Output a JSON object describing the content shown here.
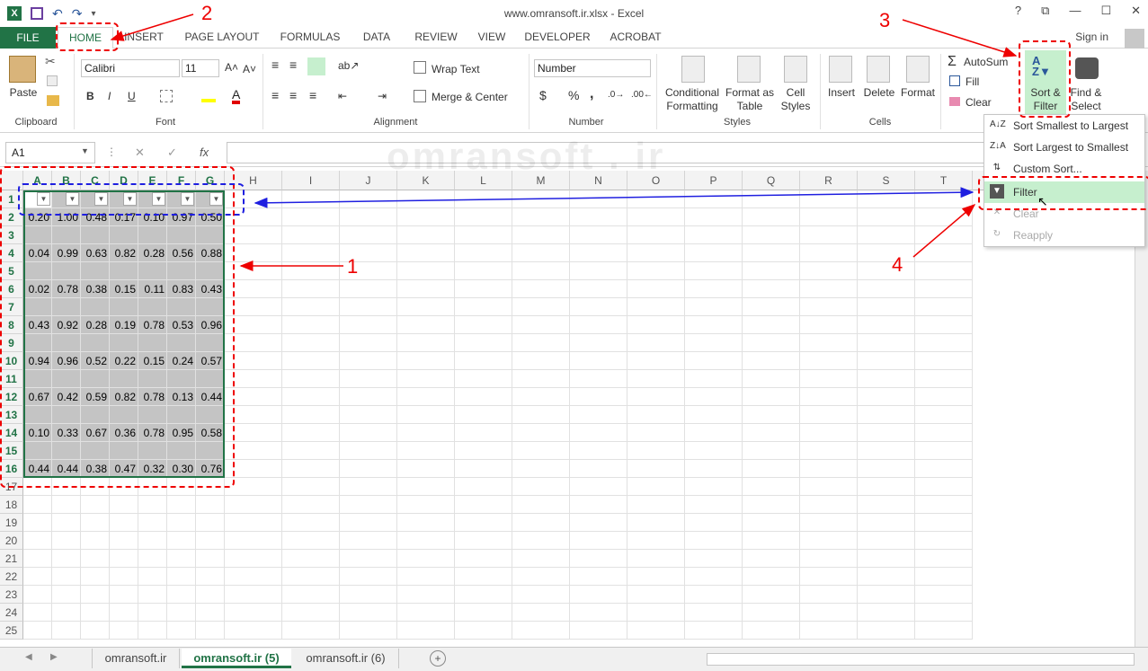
{
  "window": {
    "title": "www.omransoft.ir.xlsx - Excel",
    "help": "?",
    "restore": "⧉",
    "minimize": "—",
    "maximize": "☐",
    "close": "✕"
  },
  "tabs": [
    {
      "label": "FILE"
    },
    {
      "label": "HOME"
    },
    {
      "label": "INSERT"
    },
    {
      "label": "PAGE LAYOUT"
    },
    {
      "label": "FORMULAS"
    },
    {
      "label": "DATA"
    },
    {
      "label": "REVIEW"
    },
    {
      "label": "VIEW"
    },
    {
      "label": "DEVELOPER"
    },
    {
      "label": "ACROBAT"
    }
  ],
  "signin": "Sign in",
  "ribbon": {
    "clipboard": {
      "label": "Clipboard",
      "paste": "Paste"
    },
    "font": {
      "label": "Font",
      "name": "Calibri",
      "size": "11",
      "bold": "B",
      "italic": "I",
      "underline": "U"
    },
    "alignment": {
      "label": "Alignment",
      "wrap": "Wrap Text",
      "merge": "Merge & Center"
    },
    "number": {
      "label": "Number",
      "format": "Number",
      "currency": "$",
      "percent": "%",
      "comma": ","
    },
    "styles": {
      "label": "Styles",
      "conditional_1": "Conditional",
      "conditional_2": "Formatting",
      "format_table_1": "Format as",
      "format_table_2": "Table",
      "cell_styles_1": "Cell",
      "cell_styles_2": "Styles"
    },
    "cells": {
      "label": "Cells",
      "insert": "Insert",
      "delete": "Delete",
      "format": "Format"
    },
    "editing": {
      "autosum": "AutoSum",
      "fill": "Fill",
      "clear": "Clear",
      "sort_1": "Sort &",
      "sort_2": "Filter",
      "find_1": "Find &",
      "find_2": "Select"
    }
  },
  "formula_bar": {
    "name_box": "A1",
    "cancel": "✕",
    "enter": "✓",
    "fx": "fx",
    "value": ""
  },
  "watermark": "omransoft . ir",
  "columns": [
    "A",
    "B",
    "C",
    "D",
    "E",
    "F",
    "G",
    "H",
    "I",
    "J",
    "K",
    "L",
    "M",
    "N",
    "O",
    "P",
    "Q",
    "R",
    "S",
    "T"
  ],
  "rows": [
    "1",
    "2",
    "3",
    "4",
    "5",
    "6",
    "7",
    "8",
    "9",
    "10",
    "11",
    "12",
    "13",
    "14",
    "15",
    "16",
    "17",
    "18",
    "19",
    "20",
    "21",
    "22",
    "23",
    "24",
    "25"
  ],
  "data_rows": {
    "2": [
      "0.20",
      "1.00",
      "0.48",
      "0.17",
      "0.10",
      "0.97",
      "0.50"
    ],
    "4": [
      "0.04",
      "0.99",
      "0.63",
      "0.82",
      "0.28",
      "0.56",
      "0.88"
    ],
    "6": [
      "0.02",
      "0.78",
      "0.38",
      "0.15",
      "0.11",
      "0.83",
      "0.43"
    ],
    "8": [
      "0.43",
      "0.92",
      "0.28",
      "0.19",
      "0.78",
      "0.53",
      "0.96"
    ],
    "10": [
      "0.94",
      "0.96",
      "0.52",
      "0.22",
      "0.15",
      "0.24",
      "0.57"
    ],
    "12": [
      "0.67",
      "0.42",
      "0.59",
      "0.82",
      "0.78",
      "0.13",
      "0.44"
    ],
    "14": [
      "0.10",
      "0.33",
      "0.67",
      "0.36",
      "0.78",
      "0.95",
      "0.58"
    ],
    "16": [
      "0.44",
      "0.44",
      "0.38",
      "0.47",
      "0.32",
      "0.30",
      "0.76"
    ]
  },
  "sort_menu": [
    {
      "label": "Sort Smallest to Largest",
      "icon": "A↓Z",
      "enabled": true
    },
    {
      "label": "Sort Largest to Smallest",
      "icon": "Z↓A",
      "enabled": true
    },
    {
      "label": "Custom Sort...",
      "icon": "⇅",
      "enabled": true
    },
    {
      "label": "Filter",
      "icon": "▼",
      "enabled": true
    },
    {
      "label": "Clear",
      "icon": "✕",
      "enabled": false
    },
    {
      "label": "Reapply",
      "icon": "↻",
      "enabled": false
    }
  ],
  "sheets": [
    {
      "label": "omransoft.ir"
    },
    {
      "label": "omransoft.ir (5)"
    },
    {
      "label": "omransoft.ir (6)"
    }
  ],
  "annotations": {
    "n1": "1",
    "n2": "2",
    "n3": "3",
    "n4": "4"
  },
  "colors": {
    "excel_green": "#217346",
    "annotation_red": "#e00000",
    "annotation_blue": "#1f1fe0",
    "selection": "#c4c4c4"
  }
}
